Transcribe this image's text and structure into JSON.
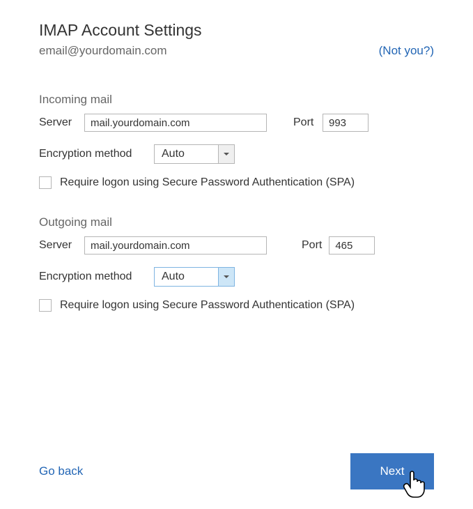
{
  "title": "IMAP Account Settings",
  "email": "email@yourdomain.com",
  "not_you": "(Not you?)",
  "incoming": {
    "heading": "Incoming mail",
    "server_label": "Server",
    "server_value": "mail.yourdomain.com",
    "port_label": "Port",
    "port_value": "993",
    "encryption_label": "Encryption method",
    "encryption_value": "Auto",
    "spa_label": "Require logon using Secure Password Authentication (SPA)"
  },
  "outgoing": {
    "heading": "Outgoing mail",
    "server_label": "Server",
    "server_value": "mail.yourdomain.com",
    "port_label": "Port",
    "port_value": "465",
    "encryption_label": "Encryption method",
    "encryption_value": "Auto",
    "spa_label": "Require logon using Secure Password Authentication (SPA)"
  },
  "footer": {
    "go_back": "Go back",
    "next": "Next"
  }
}
